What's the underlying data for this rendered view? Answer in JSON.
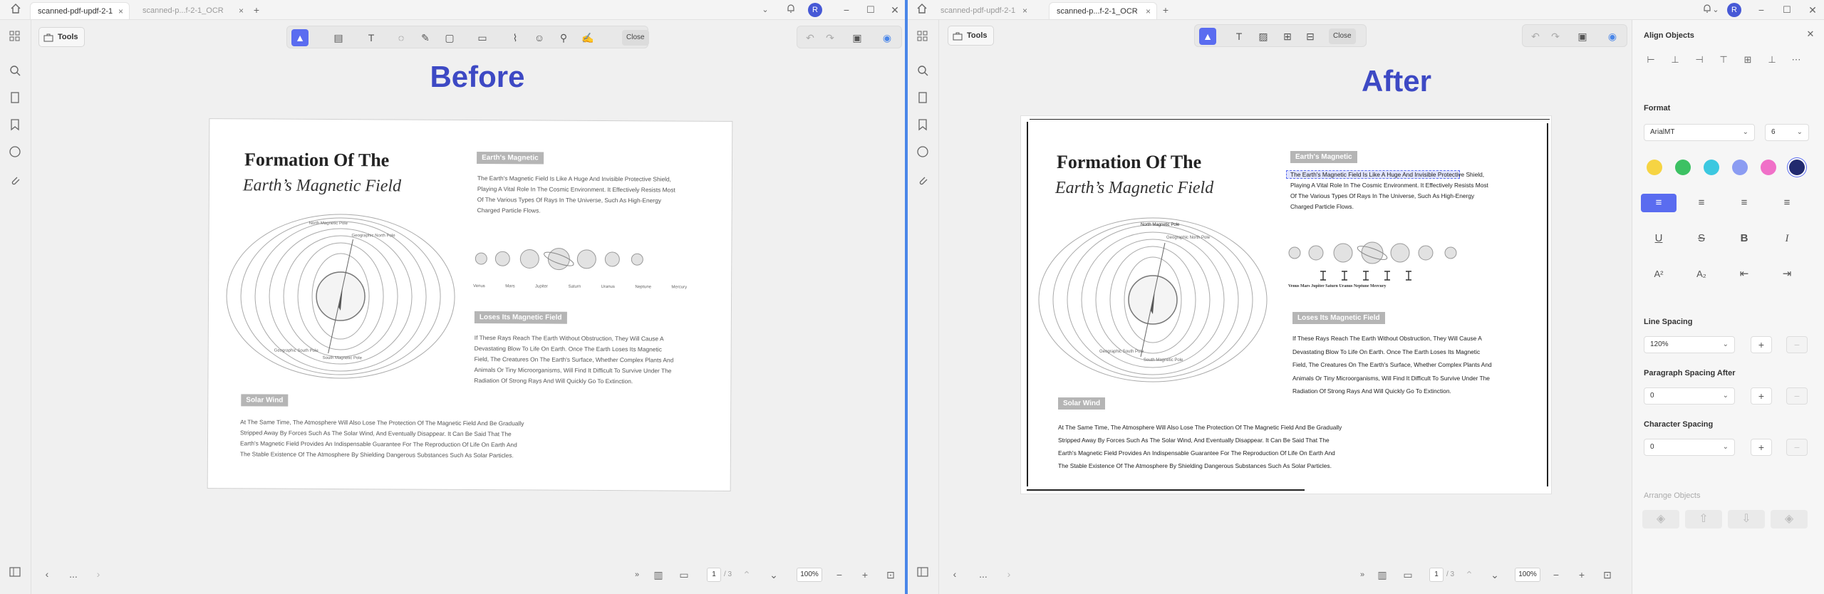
{
  "left": {
    "tabs": [
      {
        "label": "scanned-pdf-updf-2-1"
      },
      {
        "label": "scanned-p...f-2-1_OCR"
      }
    ],
    "avatar": "R",
    "tools_label": "Tools",
    "close_label": "Close",
    "heading": "Before",
    "page_indicator": {
      "current": "1",
      "total": "/ 3"
    },
    "zoom": "100%",
    "nav_more": "..."
  },
  "right": {
    "tabs": [
      {
        "label": "scanned-pdf-updf-2-1"
      },
      {
        "label": "scanned-p...f-2-1_OCR"
      }
    ],
    "avatar": "R",
    "tools_label": "Tools",
    "close_label": "Close",
    "heading": "After",
    "page_indicator": {
      "current": "1",
      "total": "/ 3"
    },
    "zoom": "100%",
    "nav_more": "..."
  },
  "doc": {
    "title_line1": "Formation Of The",
    "title_line2": "Earth’s Magnetic Field",
    "section1": {
      "heading": "Earth's Magnetic",
      "lines": [
        "The Earth's Magnetic Field Is Like A Huge And Invisible Protective Shield,",
        "Playing A Vital Role In The Cosmic Environment. It Effectively Resists Most",
        "Of The Various Types Of Rays In The Universe, Such As High-Energy",
        "Charged Particle Flows."
      ]
    },
    "planets_before": [
      "Venus",
      "Mars",
      "Jupiter",
      "Saturn",
      "Uranus",
      "Neptune",
      "Mercury"
    ],
    "planets_after": "Venus Mars Jupiter Saturn Uranus Neptune Mercury",
    "section2": {
      "heading": "Loses Its Magnetic Field",
      "lines": [
        "If These Rays Reach The Earth Without Obstruction, They Will Cause A",
        "Devastating Blow To Life On Earth. Once The Earth Loses Its Magnetic",
        "Field, The Creatures On The Earth's Surface, Whether Complex Plants And",
        "Animals Or Tiny Microorganisms, Will Find It Difficult To Survive Under The",
        "Radiation Of Strong Rays And Will Quickly Go To Extinction."
      ]
    },
    "section3": {
      "heading": "Solar Wind",
      "lines": [
        "At The Same Time, The Atmosphere Will Also Lose The Protection Of The Magnetic Field And Be Gradually",
        "Stripped Away By Forces Such As The Solar Wind, And Eventually Disappear. It Can Be Said That The",
        "Earth's Magnetic Field Provides An Indispensable Guarantee For The Reproduction Of Life On Earth And",
        "The Stable Existence Of The Atmosphere By Shielding Dangerous Substances Such As Solar Particles."
      ]
    },
    "diagram_labels": {
      "north_mag": "North Magnetic Pole",
      "geo_north": "Geographic North Pole",
      "geo_south": "Geographic South Pole",
      "south_mag": "South Magnetic Pole"
    }
  },
  "panel": {
    "align_title": "Align Objects",
    "format_title": "Format",
    "font_name": "ArialMT",
    "font_size": "6",
    "colors": [
      "#f6d443",
      "#3cc163",
      "#3cc8e0",
      "#8b9cf2",
      "#f070c8",
      "#222a6e"
    ],
    "line_spacing_title": "Line Spacing",
    "line_spacing_value": "120%",
    "para_spacing_title": "Paragraph Spacing After",
    "para_spacing_value": "0",
    "char_spacing_title": "Character Spacing",
    "char_spacing_value": "0",
    "arrange_title": "Arrange Objects"
  }
}
